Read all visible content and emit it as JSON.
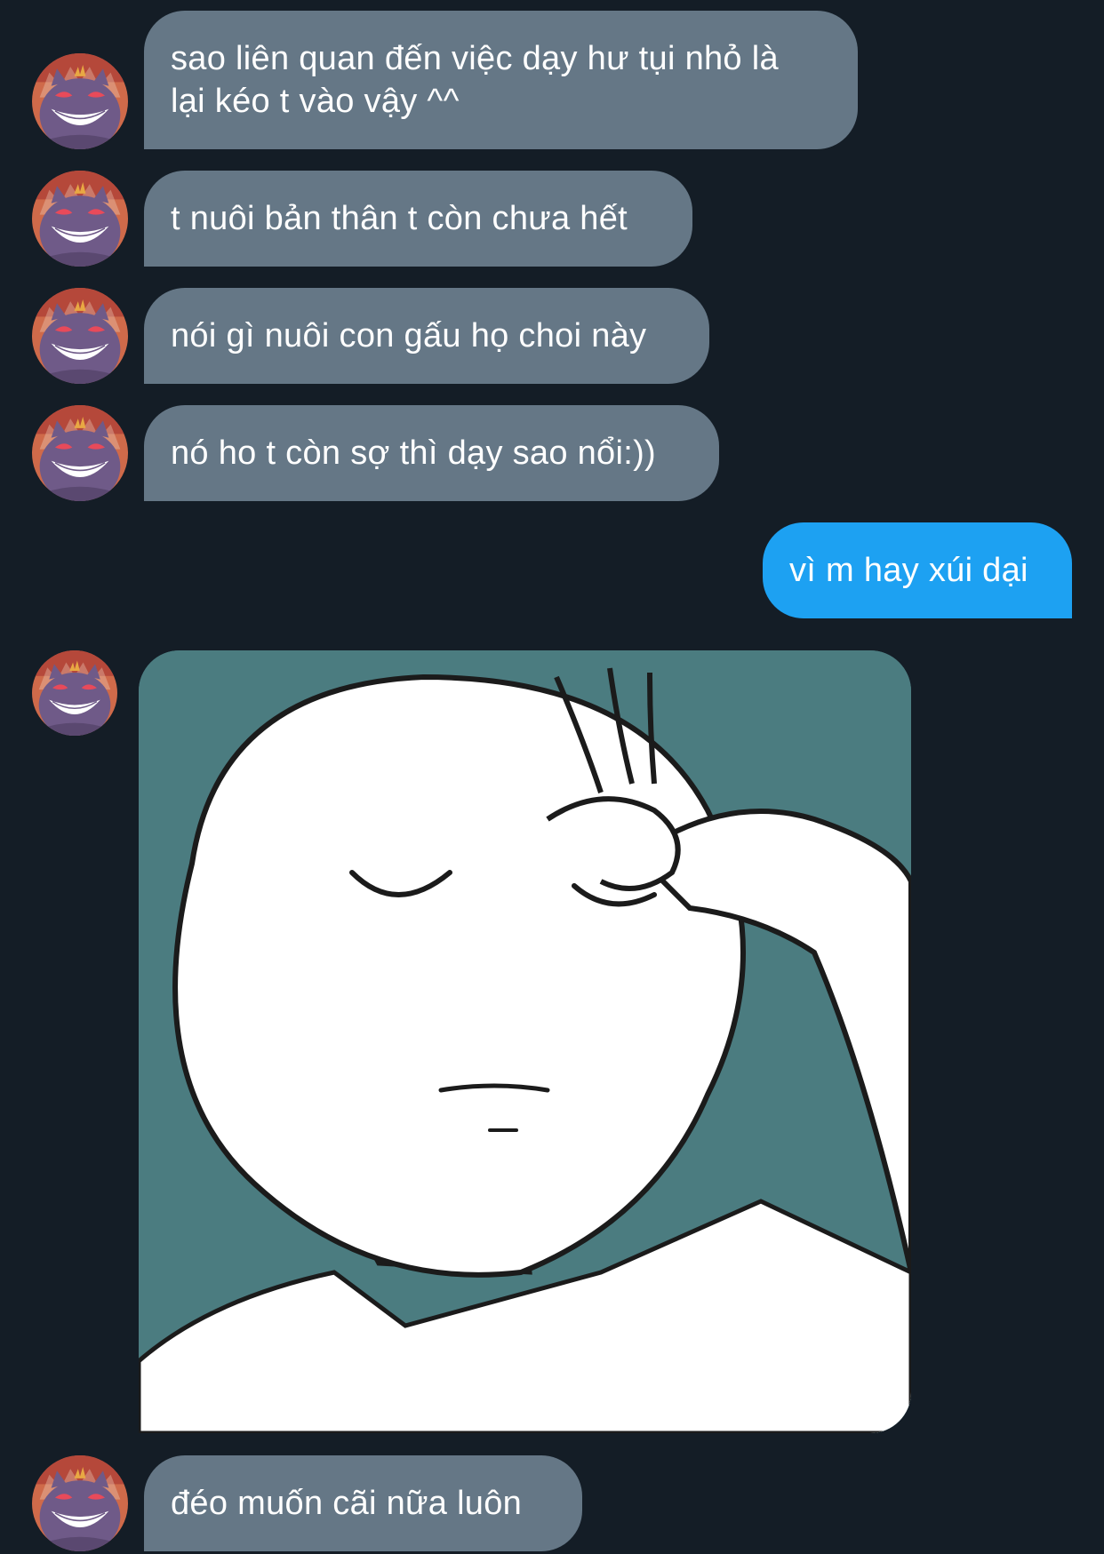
{
  "conversation": {
    "messages": [
      {
        "sender": "them",
        "text": "sao liên quan đến việc dạy hư tụi nhỏ là\nlại kéo t vào vậy ^^"
      },
      {
        "sender": "them",
        "text": "t nuôi bản thân t còn chưa hết"
      },
      {
        "sender": "them",
        "text": "nói gì nuôi con gấu họ choi này"
      },
      {
        "sender": "them",
        "text": "nó ho t còn sợ thì dạy sao nổi:))"
      },
      {
        "sender": "me",
        "text": "vì m hay xúi dại"
      },
      {
        "sender": "them",
        "type": "image",
        "image_subject": "facepalm-meme"
      },
      {
        "sender": "them",
        "text": "đéo muốn cãi nữa luôn"
      }
    ],
    "avatar_icon": "gengar-avatar-icon"
  },
  "theme": {
    "background": "#141d26",
    "incoming_bubble": "#657786",
    "outgoing_bubble": "#1da1f2",
    "text": "#ffffff"
  }
}
